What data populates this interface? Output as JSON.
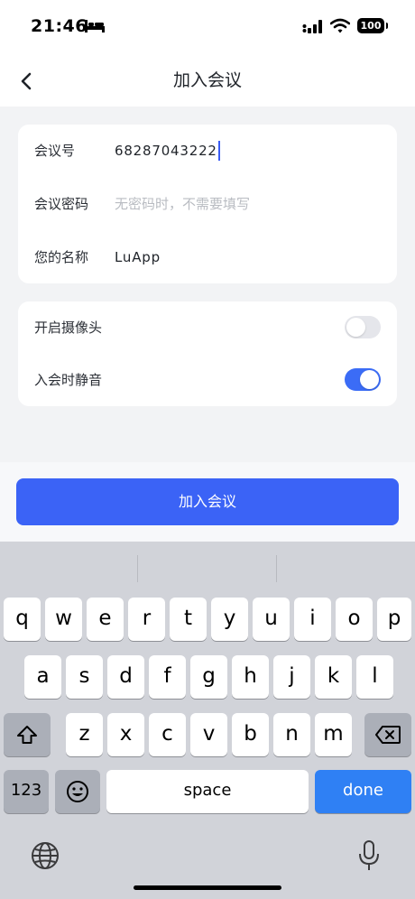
{
  "status_bar": {
    "time": "21:46",
    "battery": "100"
  },
  "nav": {
    "title": "加入会议"
  },
  "form": {
    "meeting_id_label": "会议号",
    "meeting_id_value": "68287043222",
    "password_label": "会议密码",
    "password_placeholder": "无密码时，不需要填写",
    "name_label": "您的名称",
    "name_value": "LuApp"
  },
  "settings": {
    "camera_label": "开启摄像头",
    "camera_on": false,
    "mute_label": "入会时静音",
    "mute_on": true
  },
  "join_button": "加入会议",
  "keyboard": {
    "row1": [
      "q",
      "w",
      "e",
      "r",
      "t",
      "y",
      "u",
      "i",
      "o",
      "p"
    ],
    "row2": [
      "a",
      "s",
      "d",
      "f",
      "g",
      "h",
      "j",
      "k",
      "l"
    ],
    "row3": [
      "z",
      "x",
      "c",
      "v",
      "b",
      "n",
      "m"
    ],
    "numbers_key": "123",
    "space_key": "space",
    "done_key": "done"
  },
  "colors": {
    "accent": "#3b63f6",
    "toggle_on": "#3b6cf6",
    "done_key": "#2f80f4"
  }
}
